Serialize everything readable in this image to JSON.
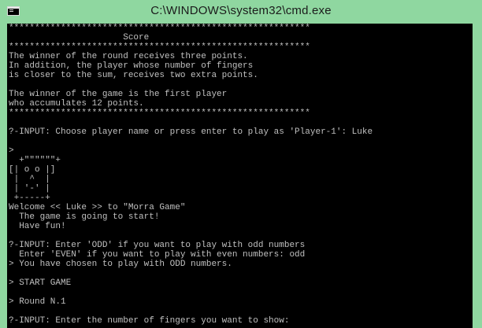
{
  "window": {
    "title": "C:\\WINDOWS\\system32\\cmd.exe",
    "icon": "console-icon",
    "colors": {
      "frame": "#8fd7a0",
      "console_bg": "#000000",
      "console_text": "#c0c0c0"
    }
  },
  "console": {
    "lines": [
      "**********************************************************",
      "                      Score",
      "**********************************************************",
      "The winner of the round receives three points.",
      "In addition, the player whose number of fingers",
      "is closer to the sum, receives two extra points.",
      "",
      "The winner of the game is the first player",
      "who accumulates 12 points.",
      "**********************************************************",
      "",
      "?-INPUT: Choose player name or press enter to play as 'Player-1': Luke",
      "",
      ">",
      "  +\"\"\"\"\"\"+",
      "[| o o |]",
      " |  ^  |",
      " | '-' |",
      " +-----+",
      "Welcome << Luke >> to \"Morra Game\"",
      "  The game is going to start!",
      "  Have fun!",
      "",
      "?-INPUT: Enter 'ODD' if you want to play with odd numbers",
      "  Enter 'EVEN' if you want to play with even numbers: odd",
      "> You have chosen to play with ODD numbers.",
      "",
      "> START GAME",
      "",
      "> Round N.1",
      "",
      "?-INPUT: Enter the number of fingers you want to show:"
    ]
  }
}
